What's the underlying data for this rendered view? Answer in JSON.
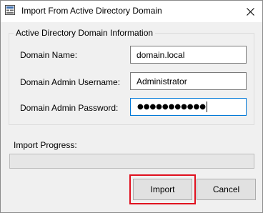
{
  "window": {
    "title": "Import From Active Directory Domain",
    "app_icon": "import-app-icon",
    "close_icon": "close-icon"
  },
  "group": {
    "legend": "Active Directory Domain Information",
    "domain_name_label": "Domain Name:",
    "domain_name_value": "domain.local",
    "username_label": "Domain Admin Username:",
    "username_value": "Administrator",
    "password_label": "Domain Admin Password:",
    "password_mask": "●●●●●●●●●●●"
  },
  "progress": {
    "label": "Import Progress:",
    "value": 0
  },
  "buttons": {
    "import_label": "Import",
    "cancel_label": "Cancel"
  },
  "colors": {
    "highlight": "#e0101e",
    "focus": "#0078d7"
  }
}
